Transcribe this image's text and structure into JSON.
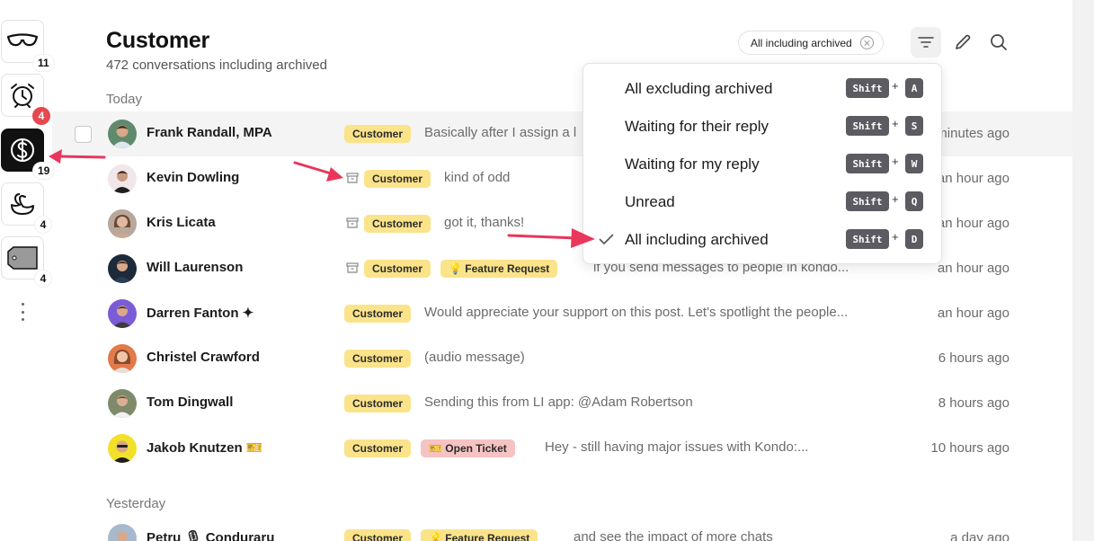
{
  "sidebar": {
    "items": [
      {
        "icon": "glasses-icon",
        "badge": "11"
      },
      {
        "icon": "alarm-clock-icon",
        "badge": "4"
      },
      {
        "icon": "dollar-icon",
        "badge": "19"
      },
      {
        "icon": "swan-icon",
        "badge": "4"
      },
      {
        "icon": "tag-icon",
        "badge": "4"
      }
    ],
    "more_icon": "more-vertical-icon"
  },
  "header": {
    "title": "Customer",
    "subtitle": "472 conversations including archived",
    "filter_chip": "All including archived"
  },
  "sections": {
    "today": "Today",
    "yesterday": "Yesterday"
  },
  "conversations": [
    {
      "name": "Frank Randall, MPA",
      "tags": [
        "Customer"
      ],
      "preview": "Basically after I assign a l",
      "time": "minutes ago"
    },
    {
      "name": "Kevin Dowling",
      "tags": [
        "Customer"
      ],
      "preview": "kind of odd",
      "time": "an hour ago"
    },
    {
      "name": "Kris Licata",
      "tags": [
        "Customer"
      ],
      "preview": "got it, thanks!",
      "time": "an hour ago"
    },
    {
      "name": "Will Laurenson",
      "tags": [
        "Customer",
        "💡 Feature Request"
      ],
      "preview": "if you send messages to people in kondo...",
      "time": "an hour ago"
    },
    {
      "name": "Darren Fanton ✦",
      "tags": [
        "Customer"
      ],
      "preview": "Would appreciate your support on this post. Let's spotlight the people...",
      "time": "an hour ago"
    },
    {
      "name": "Christel Crawford",
      "tags": [
        "Customer"
      ],
      "preview": "(audio message)",
      "time": "6 hours ago"
    },
    {
      "name": "Tom Dingwall",
      "tags": [
        "Customer"
      ],
      "preview": "Sending this from LI app: @Adam Robertson",
      "time": "8 hours ago"
    },
    {
      "name": "Jakob Knutzen 🎫",
      "tags": [
        "Customer",
        "🎫 Open Ticket"
      ],
      "preview": "Hey - still having major issues with Kondo:...",
      "time": "10 hours ago"
    },
    {
      "name": "Petru 🎙 Conduraru",
      "tags": [
        "Customer",
        "💡 Feature Request"
      ],
      "preview": "and see the impact of more chats",
      "time": "a day ago"
    }
  ],
  "filter_menu": {
    "items": [
      {
        "label": "All excluding archived",
        "shortcut_mod": "Shift",
        "shortcut_key": "A",
        "checked": false
      },
      {
        "label": "Waiting for their reply",
        "shortcut_mod": "Shift",
        "shortcut_key": "S",
        "checked": false
      },
      {
        "label": "Waiting for my reply",
        "shortcut_mod": "Shift",
        "shortcut_key": "W",
        "checked": false
      },
      {
        "label": "Unread",
        "shortcut_mod": "Shift",
        "shortcut_key": "Q",
        "checked": false
      },
      {
        "label": "All including archived",
        "shortcut_mod": "Shift",
        "shortcut_key": "D",
        "checked": true
      }
    ],
    "plus": "+"
  },
  "colors": {
    "tag_customer": "#fbe38a",
    "tag_ticket": "#f6c3c3",
    "badge_red": "#e5484d",
    "arrow": "#e8375a",
    "kbd": "#5b5b61"
  }
}
